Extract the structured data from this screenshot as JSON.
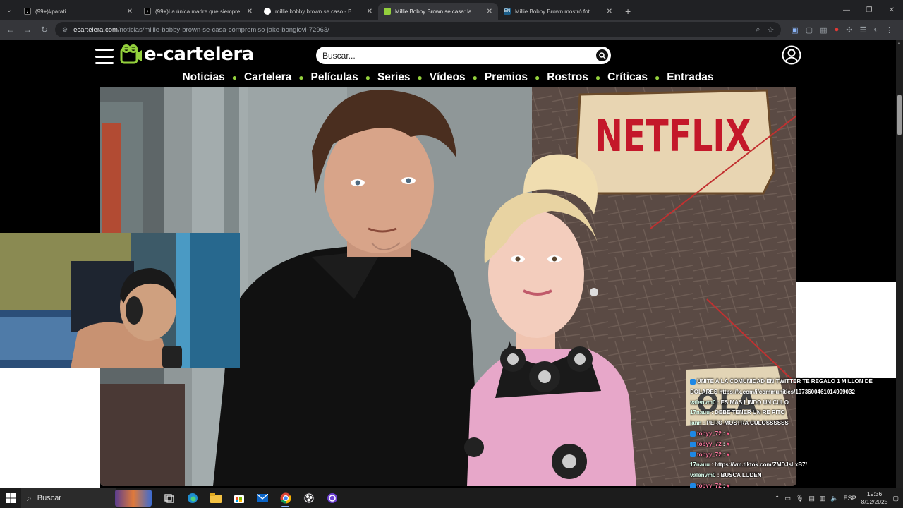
{
  "browser": {
    "tabs": [
      {
        "title": "(99+)#parati",
        "favicon": "tiktok-icon",
        "active": false
      },
      {
        "title": "(99+)La única madre que siempre",
        "favicon": "tiktok-icon",
        "active": false
      },
      {
        "title": "millie bobby brown se caso - B",
        "favicon": "google-icon",
        "active": false
      },
      {
        "title": "Millie Bobby Brown se casa: la",
        "favicon": "ecartelera-icon",
        "active": true
      },
      {
        "title": "Millie Bobby Brown mostró fot",
        "favicon": "en-icon",
        "active": false
      }
    ],
    "url_host": "ecartelera.com",
    "url_path": "/noticias/millie-bobby-brown-se-casa-compromiso-jake-bongiovi-72963/"
  },
  "site": {
    "logo_text": "e-cartelera",
    "search_placeholder": "Buscar...",
    "nav": [
      "Noticias",
      "Cartelera",
      "Películas",
      "Series",
      "Vídeos",
      "Premios",
      "Rostros",
      "Críticas",
      "Entradas"
    ],
    "hero_sign_text": "NETFLIX",
    "hero_sign_partial": "OLA"
  },
  "chat": [
    {
      "user": "",
      "text": "UNITE A LA COMUNIDAD EN TWITTER TE REGALO 1 MILLON DE",
      "badge": true
    },
    {
      "user": "",
      "text": "DOLARES https://x.com/i/communities/1973600461014909032",
      "badge": false
    },
    {
      "user": "valenvm0",
      "text": "ES MAS LINDO UN CULO",
      "badge": false
    },
    {
      "user": "17nauu",
      "text": "DEBE TENER UN RE PITO",
      "badge": false
    },
    {
      "user": "iann",
      "text": "PERO MOSTRA CULOSSSSSS",
      "badge": false
    },
    {
      "user": "tobyy_72",
      "text": "",
      "badge": true
    },
    {
      "user": "tobyy_72",
      "text": "",
      "badge": true
    },
    {
      "user": "tobyy_72",
      "text": "",
      "badge": true
    },
    {
      "user": "17nauu",
      "text": "https://vm.tiktok.com/ZMDJsLxB7/",
      "badge": false
    },
    {
      "user": "valenvm0",
      "text": "BUSCA LUDEN",
      "badge": false
    },
    {
      "user": "tobyy_72",
      "text": "",
      "badge": true
    },
    {
      "user": "tobyy_72",
      "text": "",
      "badge": true
    },
    {
      "user": "tobyy_72",
      "text": "",
      "badge": true
    }
  ],
  "taskbar": {
    "search_label": "Buscar",
    "lang": "ESP",
    "time": "19:36",
    "date": "8/12/2025"
  }
}
